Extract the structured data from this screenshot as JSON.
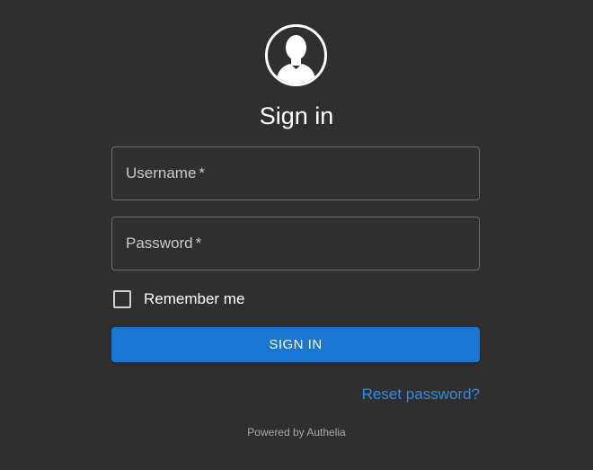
{
  "header": {
    "avatar_icon": "user-silhouette-icon",
    "title": "Sign in"
  },
  "form": {
    "username": {
      "label": "Username",
      "required_mark": "*",
      "value": ""
    },
    "password": {
      "label": "Password",
      "required_mark": "*",
      "value": ""
    },
    "remember_me": {
      "label": "Remember me",
      "checked": false
    },
    "submit_label": "SIGN IN",
    "reset_link": "Reset password?"
  },
  "footer": {
    "powered_by": "Powered by Authelia"
  },
  "colors": {
    "background": "#2f2f2f",
    "primary": "#1976d2",
    "link": "#2f8be6",
    "field_border": "#6b6b6b"
  }
}
